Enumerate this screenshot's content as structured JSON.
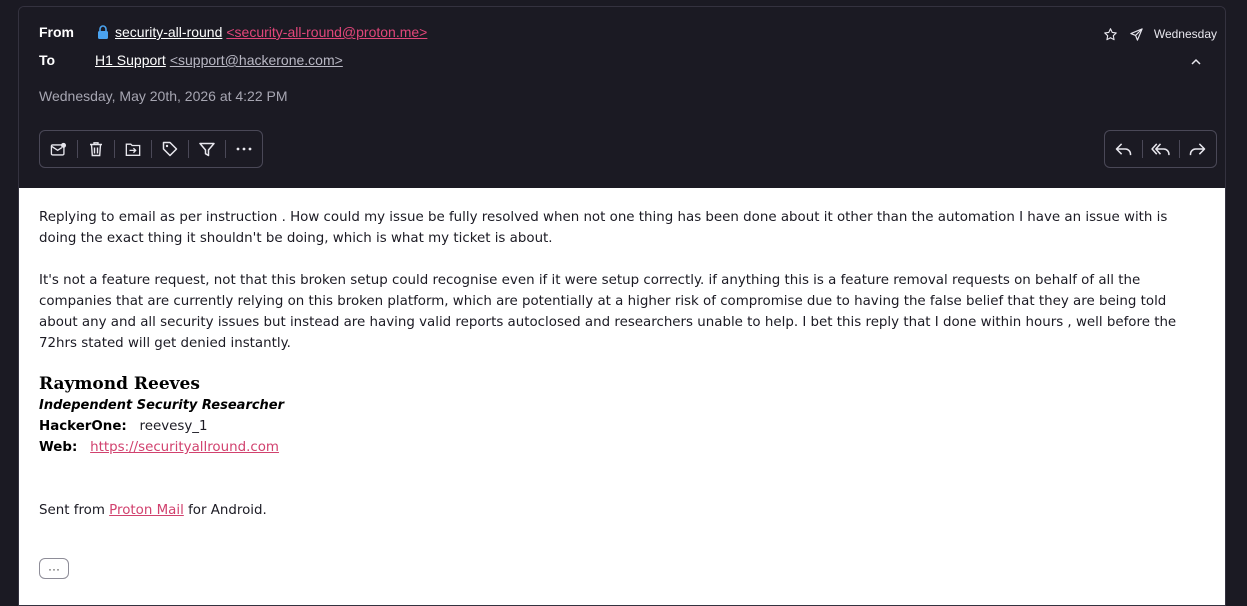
{
  "header": {
    "from_label": "From",
    "from_name": "security-all-round",
    "from_email": "<security-all-round@proton.me>",
    "to_label": "To",
    "to_name": "H1 Support",
    "to_email": "<support@hackerone.com>",
    "date_full": "Wednesday, May 20th, 2026 at 4:22 PM",
    "date_short": "Wednesday",
    "icons": [
      "lock-icon",
      "star-icon",
      "sent-icon",
      "chevron-up-icon"
    ]
  },
  "toolbar_left": [
    {
      "name": "mark-unread-icon"
    },
    {
      "name": "trash-icon"
    },
    {
      "name": "move-icon"
    },
    {
      "name": "label-icon"
    },
    {
      "name": "filter-icon"
    },
    {
      "name": "more-icon"
    }
  ],
  "toolbar_right": [
    {
      "name": "reply-icon"
    },
    {
      "name": "reply-all-icon"
    },
    {
      "name": "forward-icon"
    }
  ],
  "body": {
    "para1": "Replying to email as per instruction . How could my issue be fully resolved when not one thing has been done about it other than the automation I have an issue with is doing the exact thing it shouldn't be doing, which is what my ticket is about.",
    "para2": "It's not a feature request, not that this broken setup could recognise even if it were setup correctly. if anything this is a feature removal requests on behalf of all the companies that are currently relying on this broken platform, which are potentially at a higher risk of compromise due to having the false belief that they are being told about any and all security issues but instead are having valid reports autoclosed and researchers unable to help. I bet this reply that I done within hours , well before the 72hrs stated will get denied instantly."
  },
  "signature": {
    "name": "Raymond Reeves",
    "title": "Independent Security Researcher",
    "hackerone_label": "HackerOne:",
    "hackerone_value": "reevesy_1",
    "web_label": "Web:",
    "web_url": "https://securityallround.com"
  },
  "footer": {
    "sent_prefix": "Sent from",
    "sent_link": "Proton Mail",
    "sent_suffix": "for Android.",
    "more_label": "···"
  },
  "colors": {
    "background": "#1b1a23",
    "accent": "#e2467a",
    "link": "#d1416e"
  }
}
